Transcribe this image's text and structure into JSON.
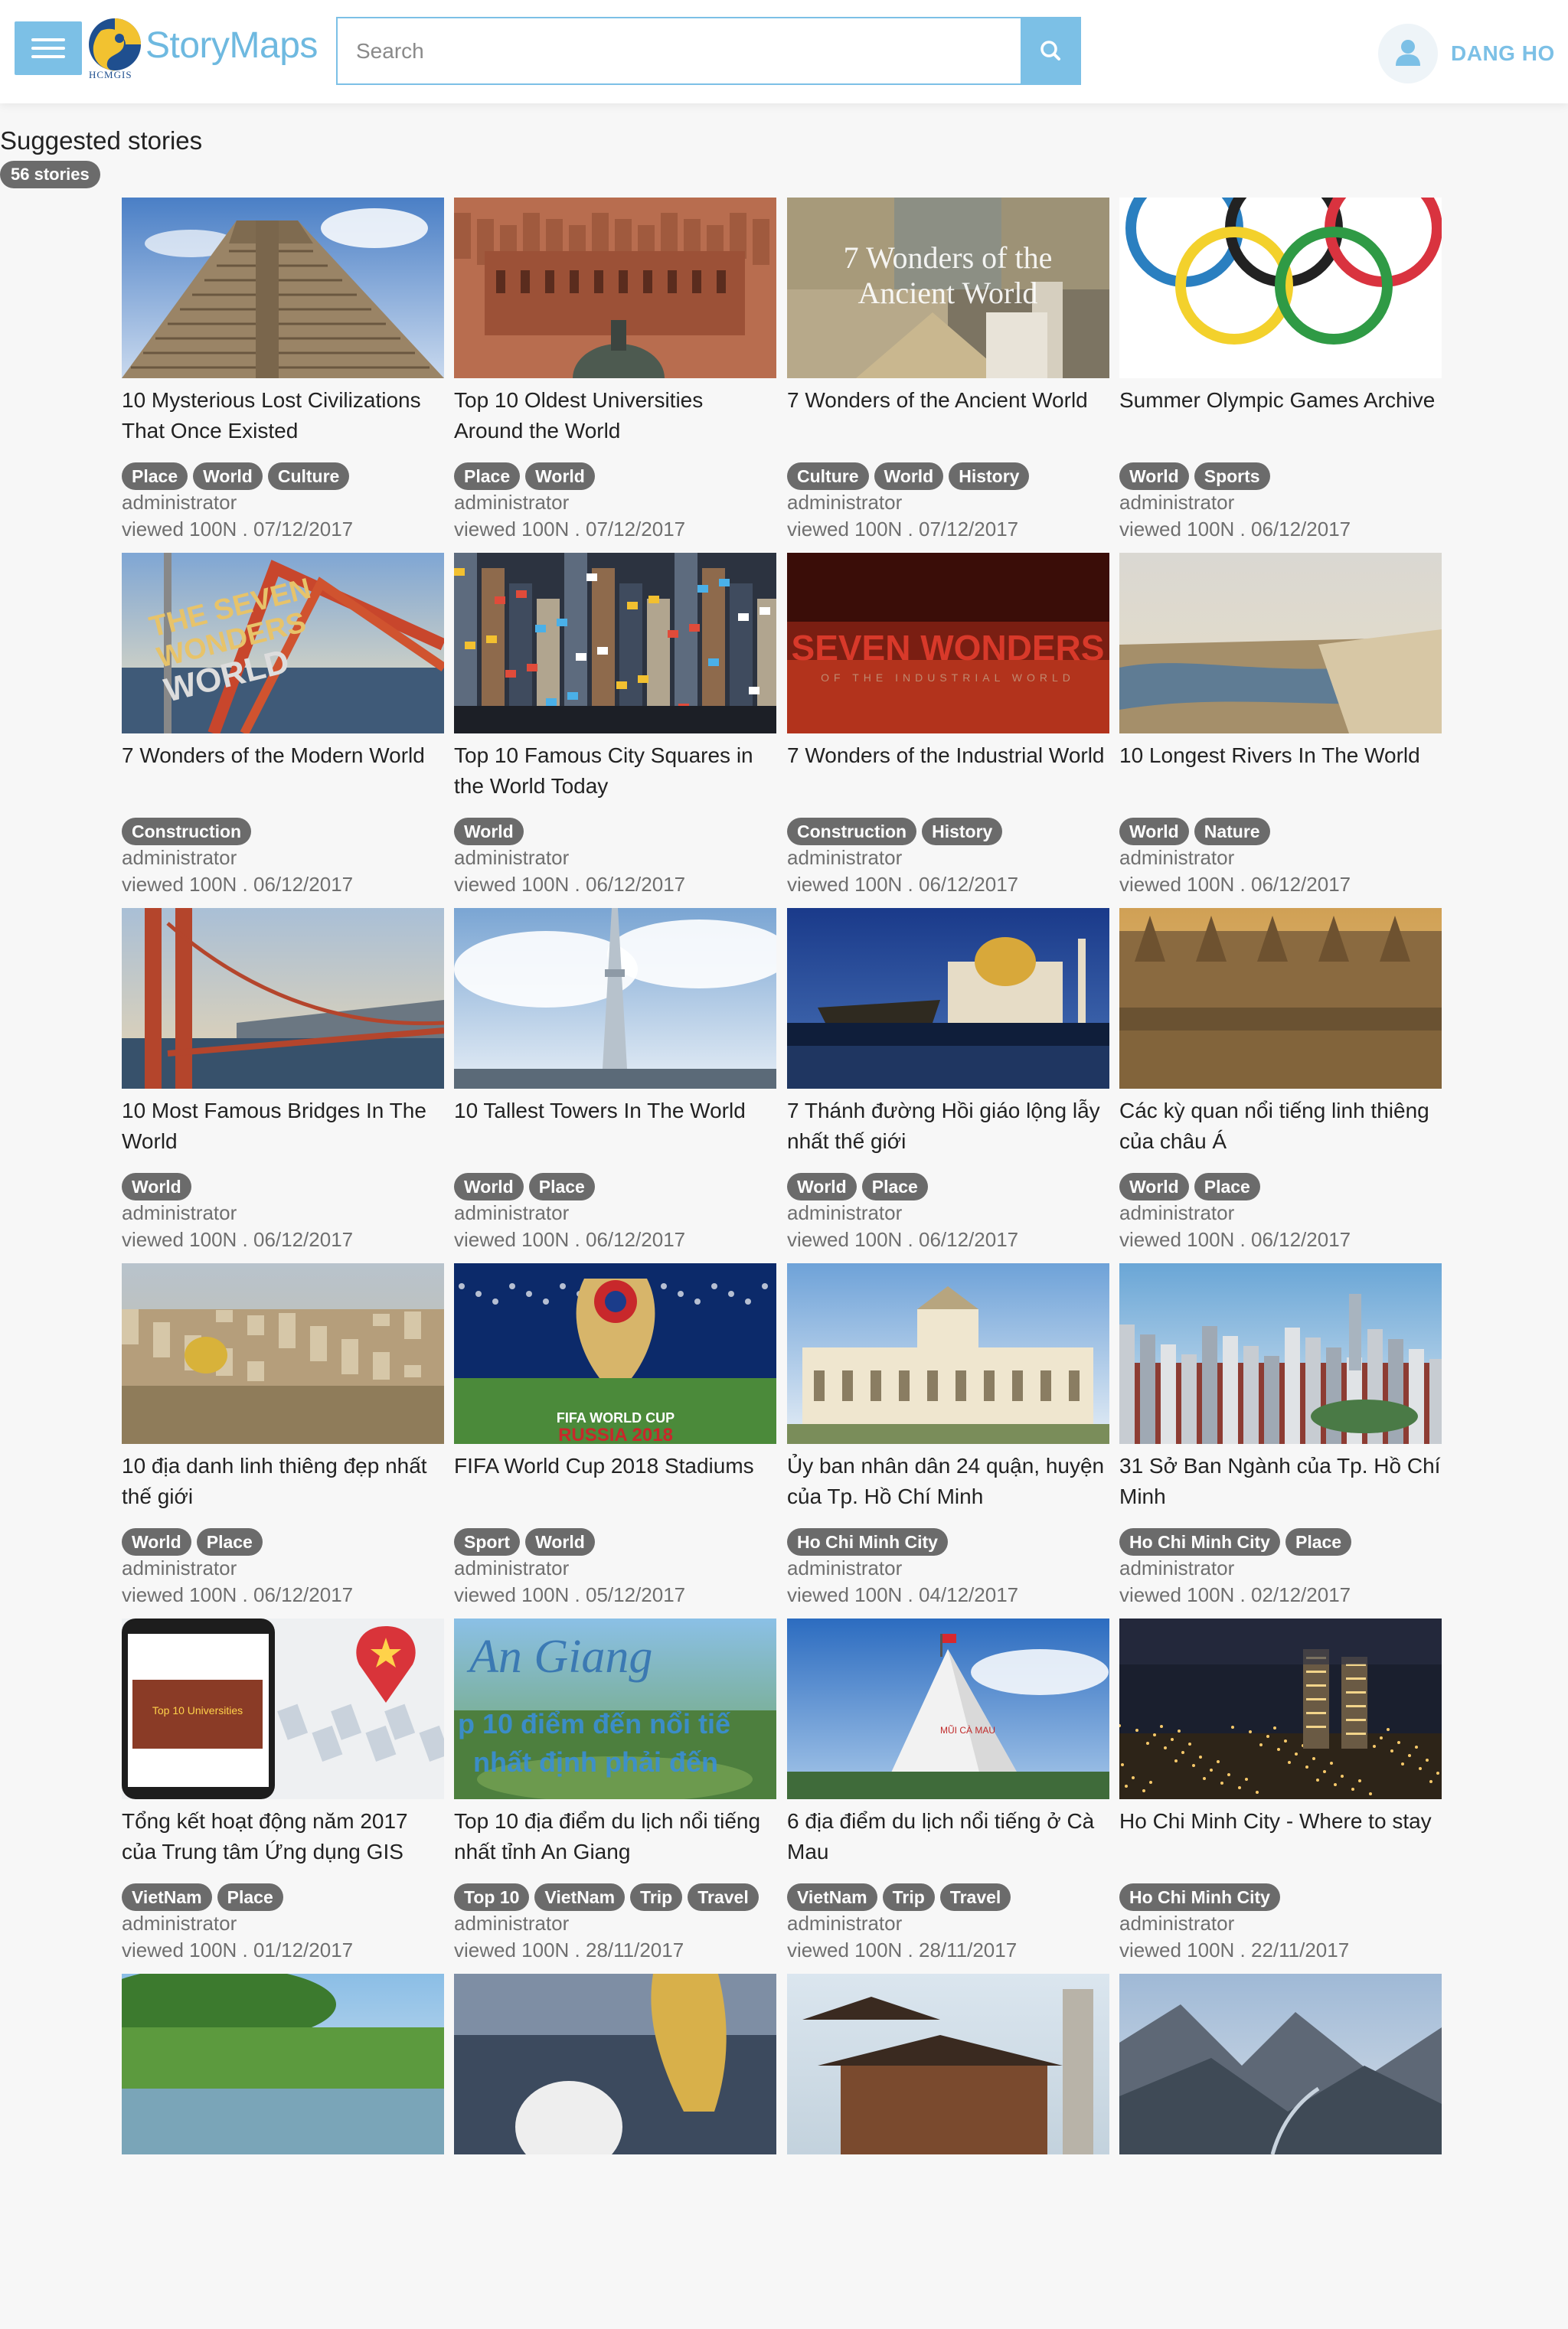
{
  "header": {
    "logo_text": "StoryMaps",
    "logo_subtext": "HCMGIS",
    "search_placeholder": "Search",
    "user_name": "DANG HO"
  },
  "section": {
    "title": "Suggested stories",
    "count": "56 stories"
  },
  "stories": [
    {
      "title": "10 Mysterious Lost Civilizations That Once Existed",
      "tags": [
        "Place",
        "World",
        "Culture"
      ],
      "author": "administrator",
      "meta": "viewed 100N . 07/12/2017",
      "thumb": "pyramid"
    },
    {
      "title": "Top 10 Oldest Universities Around the World",
      "tags": [
        "Place",
        "World"
      ],
      "author": "administrator",
      "meta": "viewed 100N . 07/12/2017",
      "thumb": "university"
    },
    {
      "title": "7 Wonders of the Ancient World",
      "tags": [
        "Culture",
        "World",
        "History"
      ],
      "author": "administrator",
      "meta": "viewed 100N . 07/12/2017",
      "thumb": "ancient"
    },
    {
      "title": "Summer Olympic Games Archive",
      "tags": [
        "World",
        "Sports"
      ],
      "author": "administrator",
      "meta": "viewed 100N . 06/12/2017",
      "thumb": "olympic"
    },
    {
      "title": "7 Wonders of the Modern World",
      "tags": [
        "Construction"
      ],
      "author": "administrator",
      "meta": "viewed 100N . 06/12/2017",
      "thumb": "modern"
    },
    {
      "title": "Top 10 Famous City Squares in the World Today",
      "tags": [
        "World"
      ],
      "author": "administrator",
      "meta": "viewed 100N . 06/12/2017",
      "thumb": "square"
    },
    {
      "title": "7 Wonders of the Industrial World",
      "tags": [
        "Construction",
        "History"
      ],
      "author": "administrator",
      "meta": "viewed 100N . 06/12/2017",
      "thumb": "industrial"
    },
    {
      "title": "10 Longest Rivers In The World",
      "tags": [
        "World",
        "Nature"
      ],
      "author": "administrator",
      "meta": "viewed 100N . 06/12/2017",
      "thumb": "river"
    },
    {
      "title": "10 Most Famous Bridges In The World",
      "tags": [
        "World"
      ],
      "author": "administrator",
      "meta": "viewed 100N . 06/12/2017",
      "thumb": "bridge"
    },
    {
      "title": "10 Tallest Towers In The World",
      "tags": [
        "World",
        "Place"
      ],
      "author": "administrator",
      "meta": "viewed 100N . 06/12/2017",
      "thumb": "tower"
    },
    {
      "title": "7 Thánh đường Hồi giáo lộng lẫy nhất thế giới",
      "tags": [
        "World",
        "Place"
      ],
      "author": "administrator",
      "meta": "viewed 100N . 06/12/2017",
      "thumb": "mosque"
    },
    {
      "title": "Các kỳ quan nổi tiếng linh thiêng của châu Á",
      "tags": [
        "World",
        "Place"
      ],
      "author": "administrator",
      "meta": "viewed 100N . 06/12/2017",
      "thumb": "temple"
    },
    {
      "title": "10 địa danh linh thiêng đẹp nhất thế giới",
      "tags": [
        "World",
        "Place"
      ],
      "author": "administrator",
      "meta": "viewed 100N . 06/12/2017",
      "thumb": "jerusalem"
    },
    {
      "title": "FIFA World Cup 2018 Stadiums",
      "tags": [
        "Sport",
        "World"
      ],
      "author": "administrator",
      "meta": "viewed 100N . 05/12/2017",
      "thumb": "fifa"
    },
    {
      "title": "Ủy ban nhân dân 24 quận, huyện của Tp. Hồ Chí Minh",
      "tags": [
        "Ho Chi Minh City"
      ],
      "author": "administrator",
      "meta": "viewed 100N . 04/12/2017",
      "thumb": "cityhall"
    },
    {
      "title": "31 Sở Ban Ngành của Tp. Hồ Chí Minh",
      "tags": [
        "Ho Chi Minh City",
        "Place"
      ],
      "author": "administrator",
      "meta": "viewed 100N . 02/12/2017",
      "thumb": "skyline"
    },
    {
      "title": "Tổng kết hoạt động năm 2017 của Trung tâm Ứng dụng GIS",
      "tags": [
        "VietNam",
        "Place"
      ],
      "author": "administrator",
      "meta": "viewed 100N . 01/12/2017",
      "thumb": "mapapp"
    },
    {
      "title": "Top 10 địa điểm du lịch nổi tiếng nhất tỉnh An Giang",
      "tags": [
        "Top 10",
        "VietNam",
        "Trip",
        "Travel"
      ],
      "author": "administrator",
      "meta": "viewed 100N . 28/11/2017",
      "thumb": "angiang"
    },
    {
      "title": "6 địa điểm du lịch nổi tiếng ở Cà Mau",
      "tags": [
        "VietNam",
        "Trip",
        "Travel"
      ],
      "author": "administrator",
      "meta": "viewed 100N . 28/11/2017",
      "thumb": "camau"
    },
    {
      "title": "Ho Chi Minh City - Where to stay",
      "tags": [
        "Ho Chi Minh City"
      ],
      "author": "administrator",
      "meta": "viewed 100N . 22/11/2017",
      "thumb": "night"
    },
    {
      "title": "",
      "tags": [],
      "author": "",
      "meta": "",
      "thumb": "field"
    },
    {
      "title": "",
      "tags": [],
      "author": "",
      "meta": "",
      "thumb": "stadium"
    },
    {
      "title": "",
      "tags": [],
      "author": "",
      "meta": "",
      "thumb": "pagoda"
    },
    {
      "title": "",
      "tags": [],
      "author": "",
      "meta": "",
      "thumb": "mountain"
    }
  ],
  "colors": {
    "accent": "#7cc0e6",
    "tag_bg": "#6b6b6b",
    "page_bg": "#f7f7f7"
  },
  "icons": {
    "menu": "hamburger-icon",
    "search": "search-icon",
    "user": "user-icon"
  }
}
